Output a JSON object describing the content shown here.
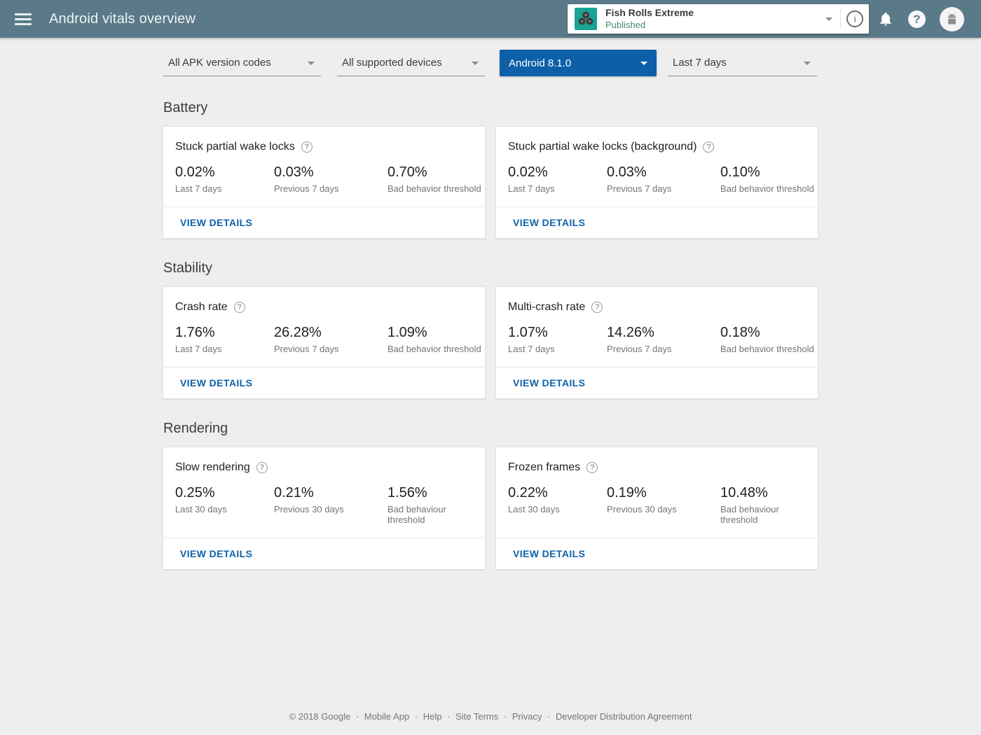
{
  "colors": {
    "header_bg": "#5b7a89",
    "accent_blue": "#0d60a8",
    "link_blue": "#0e62aa",
    "published_green": "#47876c",
    "app_icon_teal": "#18a393"
  },
  "header": {
    "title": "Android vitals overview",
    "app_selector": {
      "name": "Fish Rolls Extreme",
      "status": "Published"
    },
    "info_glyph": "i",
    "help_glyph": "?"
  },
  "filters": [
    {
      "label": "All APK version codes",
      "selected": false
    },
    {
      "label": "All supported devices",
      "selected": false
    },
    {
      "label": "Android 8.1.0",
      "selected": true
    },
    {
      "label": "Last 7 days",
      "selected": false
    }
  ],
  "help_glyph": "?",
  "sections": [
    {
      "title": "Battery",
      "cards": [
        {
          "title": "Stuck partial wake locks",
          "stats": [
            {
              "value": "0.02%",
              "label": "Last 7 days"
            },
            {
              "value": "0.03%",
              "label": "Previous 7 days"
            },
            {
              "value": "0.70%",
              "label": "Bad behavior threshold"
            }
          ],
          "action": "VIEW DETAILS"
        },
        {
          "title": "Stuck partial wake locks (background)",
          "stats": [
            {
              "value": "0.02%",
              "label": "Last 7 days"
            },
            {
              "value": "0.03%",
              "label": "Previous 7 days"
            },
            {
              "value": "0.10%",
              "label": "Bad behavior threshold"
            }
          ],
          "action": "VIEW DETAILS"
        }
      ]
    },
    {
      "title": "Stability",
      "cards": [
        {
          "title": "Crash rate",
          "stats": [
            {
              "value": "1.76%",
              "label": "Last 7 days"
            },
            {
              "value": "26.28%",
              "label": "Previous 7 days"
            },
            {
              "value": "1.09%",
              "label": "Bad behavior threshold"
            }
          ],
          "action": "VIEW DETAILS"
        },
        {
          "title": "Multi-crash rate",
          "stats": [
            {
              "value": "1.07%",
              "label": "Last 7 days"
            },
            {
              "value": "14.26%",
              "label": "Previous 7 days"
            },
            {
              "value": "0.18%",
              "label": "Bad behavior threshold"
            }
          ],
          "action": "VIEW DETAILS"
        }
      ]
    },
    {
      "title": "Rendering",
      "cards": [
        {
          "title": "Slow rendering",
          "stats": [
            {
              "value": "0.25%",
              "label": "Last 30 days"
            },
            {
              "value": "0.21%",
              "label": "Previous 30 days"
            },
            {
              "value": "1.56%",
              "label": "Bad behaviour threshold"
            }
          ],
          "action": "VIEW DETAILS"
        },
        {
          "title": "Frozen frames",
          "stats": [
            {
              "value": "0.22%",
              "label": "Last 30 days"
            },
            {
              "value": "0.19%",
              "label": "Previous 30 days"
            },
            {
              "value": "10.48%",
              "label": "Bad behaviour threshold"
            }
          ],
          "action": "VIEW DETAILS"
        }
      ]
    }
  ],
  "footer": {
    "copyright": "© 2018 Google",
    "separator": "·",
    "links": [
      "Mobile App",
      "Help",
      "Site Terms",
      "Privacy",
      "Developer Distribution Agreement"
    ]
  }
}
